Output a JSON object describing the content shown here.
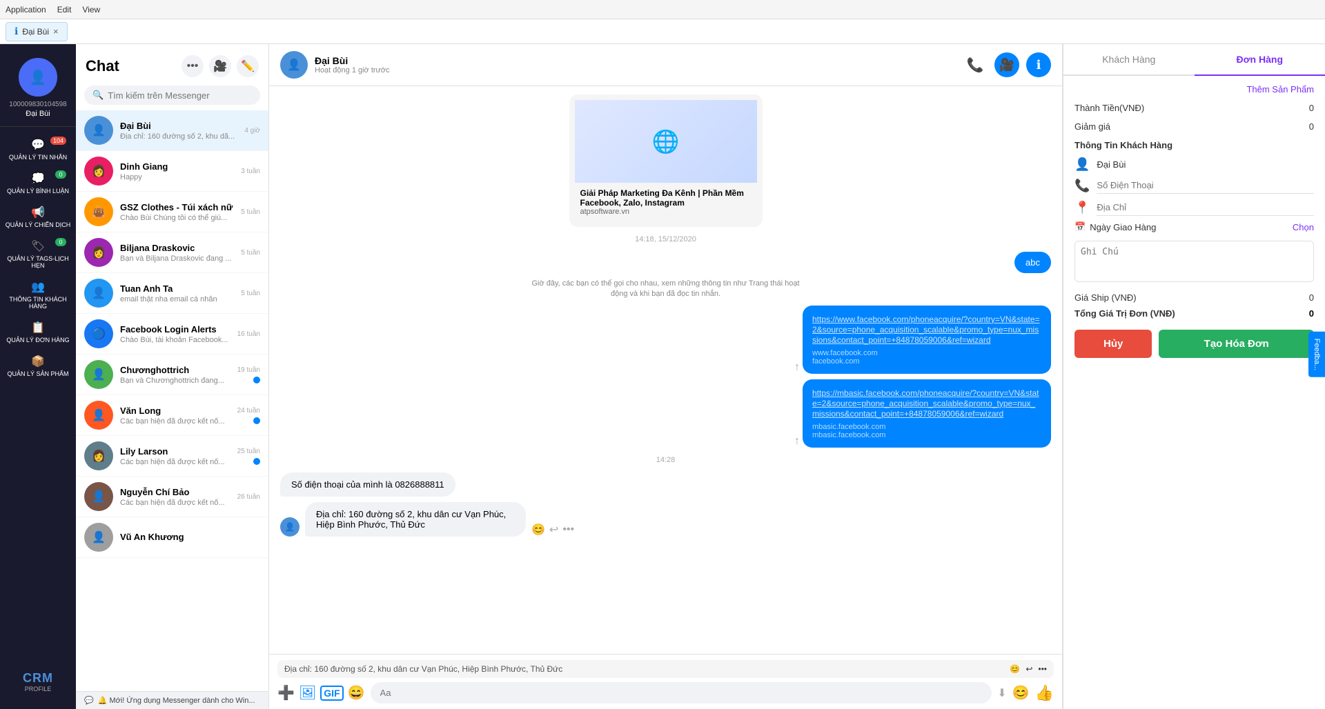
{
  "topbar": {
    "menus": [
      "Application",
      "Edit",
      "View"
    ]
  },
  "tab": {
    "label": "Đại Bùi",
    "close": "×"
  },
  "sidebar": {
    "user_id": "100009830104598",
    "user_name": "Đại Bùi",
    "nav_items": [
      {
        "id": "tin-nhan",
        "label": "QUẢN LÝ TIN NHẮN",
        "badge": "104",
        "badge_type": "red"
      },
      {
        "id": "binh-luan",
        "label": "QUẢN LÝ BÌNH LUẬN",
        "badge": "0",
        "badge_type": "green"
      },
      {
        "id": "chien-dich",
        "label": "QUẢN LÝ CHIẾN DỊCH",
        "badge": "",
        "badge_type": ""
      },
      {
        "id": "tags-lich",
        "label": "QUẢN LÝ TAGS-LỊCH HẸN",
        "badge": "0",
        "badge_type": "green"
      },
      {
        "id": "khach-hang",
        "label": "THÔNG TIN KHÁCH HÀNG",
        "badge": "",
        "badge_type": ""
      },
      {
        "id": "don-hang",
        "label": "QUẢN LÝ ĐƠN HÀNG",
        "badge": "",
        "badge_type": ""
      },
      {
        "id": "san-pham",
        "label": "QUẢN LÝ SẢN PHẨM",
        "badge": "",
        "badge_type": ""
      }
    ],
    "logo": "CRM",
    "logo_sub": "PROFILE"
  },
  "chat_list": {
    "title": "Chat",
    "search_placeholder": "Tìm kiếm trên Messenger",
    "items": [
      {
        "name": "Đại Bùi",
        "preview": "Địa chỉ: 160 đường số 2, khu dã...",
        "time": "4 giờ",
        "unread": false,
        "active": true,
        "avatar_color": "#4a90d9",
        "avatar_icon": "👤"
      },
      {
        "name": "Dinh Giang",
        "preview": "Happy",
        "time": "3 tuần",
        "unread": false,
        "active": false,
        "avatar_color": "#e91e63",
        "avatar_icon": "👩"
      },
      {
        "name": "GSZ Clothes - Túi xách nữ",
        "preview": "Chào Bùi Chúng tôi có thể giú...",
        "time": "5 tuần",
        "unread": false,
        "active": false,
        "avatar_color": "#ff9800",
        "avatar_icon": "👜"
      },
      {
        "name": "Biljana Draskovic",
        "preview": "Bạn và Biljana Draskovic đang ...",
        "time": "5 tuần",
        "unread": false,
        "active": false,
        "avatar_color": "#9c27b0",
        "avatar_icon": "👩"
      },
      {
        "name": "Tuan Anh Ta",
        "preview": "email thật nha email cá nhân",
        "time": "5 tuần",
        "unread": false,
        "active": false,
        "avatar_color": "#2196f3",
        "avatar_icon": "👤"
      },
      {
        "name": "Facebook Login Alerts",
        "preview": "Chào Bùi, tài khoản Facebook...",
        "time": "16 tuần",
        "unread": false,
        "active": false,
        "avatar_color": "#1877f2",
        "avatar_icon": "🔵"
      },
      {
        "name": "Chươnghottrich",
        "preview": "Bạn và Chươnghottrich đang...",
        "time": "19 tuần",
        "unread": true,
        "active": false,
        "avatar_color": "#4caf50",
        "avatar_icon": "👤"
      },
      {
        "name": "Văn Long",
        "preview": "Các bạn hiện đã được kết nố...",
        "time": "24 tuần",
        "unread": true,
        "active": false,
        "avatar_color": "#ff5722",
        "avatar_icon": "👤"
      },
      {
        "name": "Lily Larson",
        "preview": "Các bạn hiện đã được kết nố...",
        "time": "25 tuần",
        "unread": true,
        "active": false,
        "avatar_color": "#607d8b",
        "avatar_icon": "👩"
      },
      {
        "name": "Nguyễn Chí Bảo",
        "preview": "Các bạn hiện đã được kết nố...",
        "time": "26 tuần",
        "unread": false,
        "active": false,
        "avatar_color": "#795548",
        "avatar_icon": "👤"
      },
      {
        "name": "Vũ An Khương",
        "preview": "",
        "time": "",
        "unread": false,
        "active": false,
        "avatar_color": "#9e9e9e",
        "avatar_icon": "👤"
      }
    ],
    "new_msg_bar": "🔔 Mới! Ứng dụng Messenger dành cho Win..."
  },
  "chat_main": {
    "contact_name": "Đại Bùi",
    "contact_status": "Hoạt động 1 giờ trước",
    "messages": [
      {
        "type": "link_preview",
        "direction": "incoming",
        "title": "Giải Pháp Marketing Đa Kênh | Phần Mềm Facebook, Zalo, Instagram",
        "domain": "atpsoftware.vn"
      },
      {
        "type": "timestamp",
        "value": "14:18, 15/12/2020"
      },
      {
        "type": "outgoing_label",
        "value": "abc"
      },
      {
        "type": "system",
        "value": "Giờ đây, các bạn có thể gọi cho nhau, xem những thông tin như Trang thái hoạt động và khi bạn đã đọc tin nhắn."
      },
      {
        "type": "link_card",
        "direction": "outgoing",
        "link": "https://www.facebook.com/phoneacquire/?country=VN&state=2&source=phone_acquisition_scalable&promo_type=nux_missions&contact_point=+84878059006&ref=wizard",
        "domain": "www.facebook.com",
        "domain_sub": "facebook.com"
      },
      {
        "type": "link_card",
        "direction": "outgoing",
        "link": "https://mbasic.facebook.com/phoneacquire/?country=VN&state=2&source=phone_acquisition_scalable&promo_type=nux_missions&contact_point=+84878059006&ref=wizard",
        "domain": "mbasic.facebook.com",
        "domain_sub": "mbasic.facebook.com"
      },
      {
        "type": "timestamp",
        "value": "14:28"
      },
      {
        "type": "bubble",
        "direction": "incoming",
        "text": "Số điện thoại của mình là 0826888811"
      },
      {
        "type": "bubble_with_avatar",
        "direction": "incoming",
        "text": "Địa chỉ: 160 đường số 2, khu dân cư Vạn Phúc, Hiệp Bình Phước, Thủ Đức"
      }
    ],
    "input_placeholder": "Aa",
    "reply_preview": "Địa chỉ: 160 đường số 2, khu dân cư Vạn Phúc, Hiệp Bình Phước, Thủ Đức"
  },
  "right_panel": {
    "tabs": [
      "Khách Hàng",
      "Đơn Hàng"
    ],
    "active_tab": "Đơn Hàng",
    "add_product_label": "Thêm Sản Phẩm",
    "thanh_tien_label": "Thành Tiền(VNĐ)",
    "thanh_tien_value": "0",
    "giam_gia_label": "Giảm giá",
    "giam_gia_value": "0",
    "thong_tin_label": "Thông Tin Khách Hàng",
    "customer_name": "Đại Bùi",
    "phone_placeholder": "Số Điện Thoại",
    "address_placeholder": "Địa Chỉ",
    "date_label": "Ngày Giao Hàng",
    "chon_label": "Chọn",
    "note_placeholder": "Ghi Chú",
    "gia_ship_label": "Giá Ship (VNĐ)",
    "gia_ship_value": "0",
    "tong_gia_label": "Tổng Giá Trị Đơn (VNĐ)",
    "tong_gia_value": "0",
    "btn_huy": "Hủy",
    "btn_tao": "Tạo Hóa Đơn"
  }
}
